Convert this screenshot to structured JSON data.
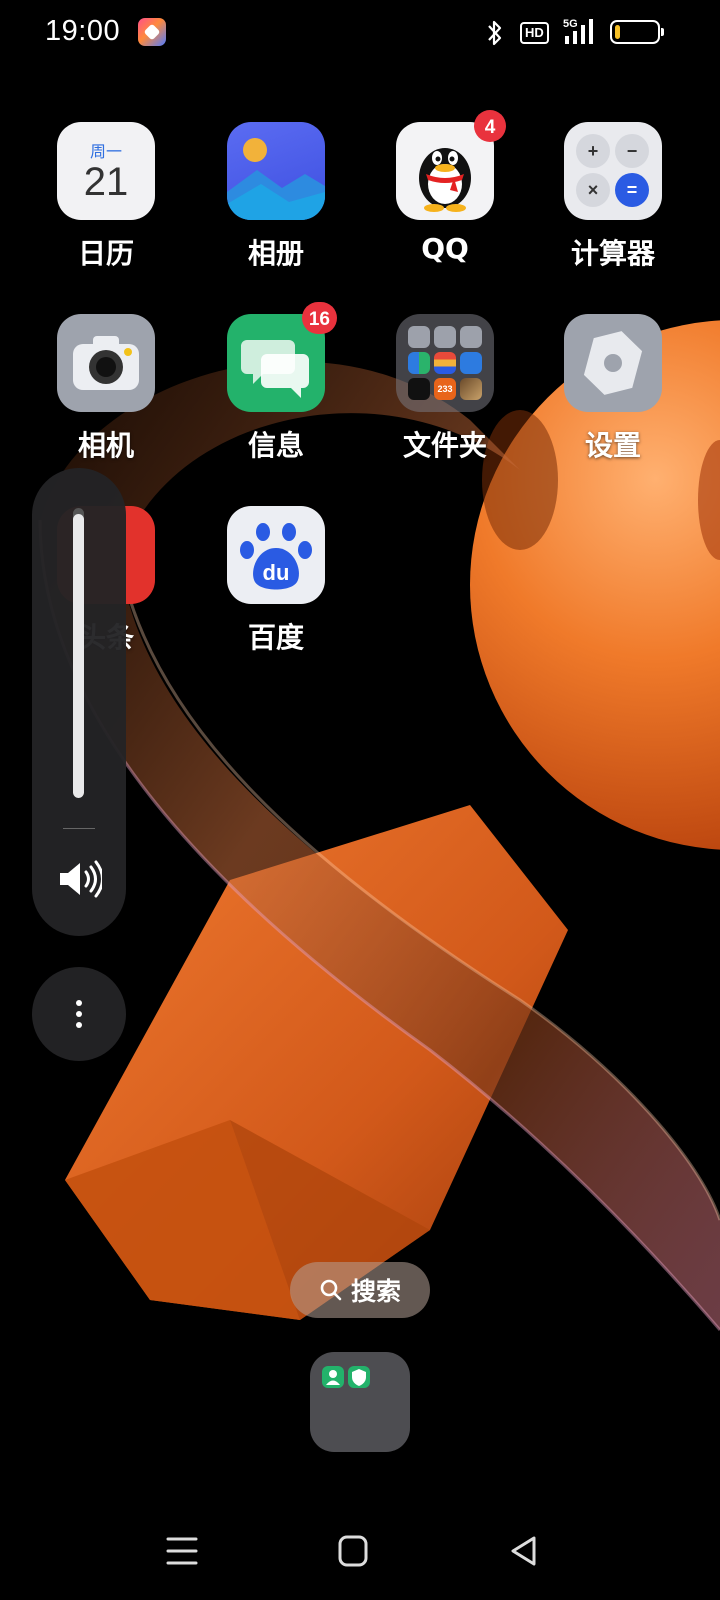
{
  "status_bar": {
    "time": "19:00",
    "app_icon": "theme-app-icon",
    "hd_label": "HD",
    "network_label": "5G",
    "battery_level": 0.12
  },
  "apps": [
    {
      "label": "日历",
      "icon": "calendar-icon",
      "weekday": "周一",
      "day": "21"
    },
    {
      "label": "相册",
      "icon": "gallery-icon"
    },
    {
      "label": "QQ",
      "icon": "qq-penguin-icon",
      "badge": "4"
    },
    {
      "label": "计算器",
      "icon": "calculator-icon",
      "keys": [
        "+",
        "−",
        "×",
        "="
      ]
    },
    {
      "label": "相机",
      "icon": "camera-icon"
    },
    {
      "label": "信息",
      "icon": "messages-icon",
      "badge": "16"
    },
    {
      "label": "文件夹",
      "icon": "folder-icon",
      "mini_text": "233"
    },
    {
      "label": "设置",
      "icon": "settings-gear-icon"
    },
    {
      "label": "头条",
      "icon": "toutiao-icon"
    },
    {
      "label": "百度",
      "icon": "baidu-paw-icon",
      "brand_text": "du"
    }
  ],
  "volume": {
    "level": 0.98,
    "speaker_icon": "speaker-icon",
    "more_icon": "more-vertical-icon"
  },
  "search": {
    "label": "搜索",
    "icon": "search-icon"
  },
  "dock": {
    "folder_icon": "dock-folder-icon"
  },
  "nav": {
    "menu_icon": "menu-icon",
    "home_icon": "home-icon",
    "back_icon": "back-icon"
  },
  "colors": {
    "badge": "#e9323d",
    "calendar_accent": "#2f6fe0",
    "messages_green": "#23b26b",
    "baidu_blue": "#2a5be3",
    "wallpaper_orange": "#e2611a"
  }
}
